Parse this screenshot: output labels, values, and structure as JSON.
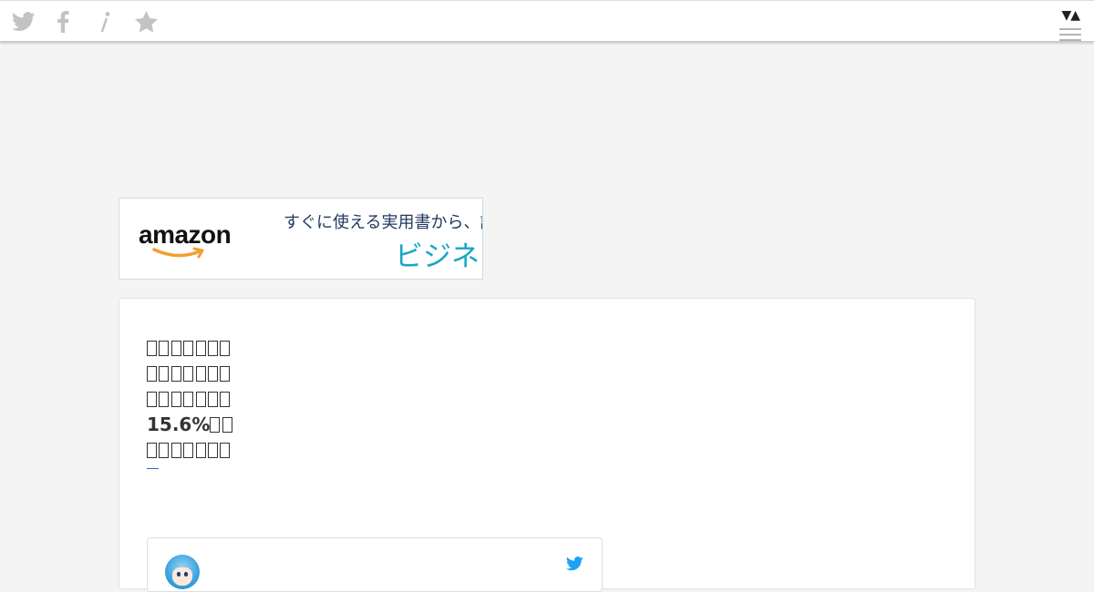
{
  "topbar": {
    "icons": [
      "twitter-icon",
      "facebook-icon",
      "info-icon",
      "star-icon"
    ],
    "sort_arrows": "▼▲"
  },
  "ad": {
    "logo_text": "amazon",
    "line1": "すぐに使える実用書から、話",
    "line2": "ビジネス"
  },
  "card": {
    "lines": [
      {
        "prefix": "",
        "tofu_count": 7
      },
      {
        "prefix": "",
        "tofu_count": 7
      },
      {
        "prefix": "",
        "tofu_count": 7
      },
      {
        "prefix": "15.6%",
        "tofu_count": 2
      },
      {
        "prefix": "",
        "tofu_count": 7
      }
    ]
  },
  "colors": {
    "page_bg": "#f4f4f4",
    "card_bg": "#ffffff",
    "amazon_orange": "#f0a030",
    "ad_teal": "#18a6c4",
    "twitter_blue": "#1da1f2",
    "icon_gray": "#c3c3c3"
  }
}
